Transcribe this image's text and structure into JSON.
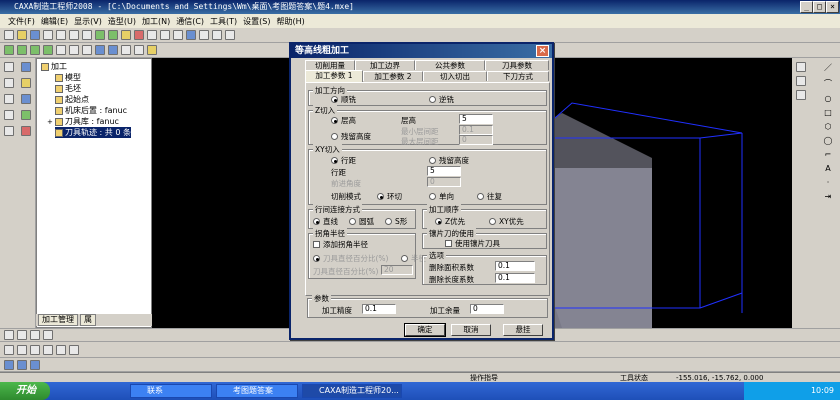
{
  "app": {
    "title": "CAXA制造工程师2008 - [C:\\Documents and Settings\\Wm\\桌面\\考图题答案\\题4.mxe]"
  },
  "menu": [
    "文件(F)",
    "编辑(E)",
    "显示(V)",
    "造型(U)",
    "加工(N)",
    "通信(C)",
    "工具(T)",
    "设置(S)",
    "帮助(H)"
  ],
  "tree": {
    "root": "加工",
    "items": [
      "模型",
      "毛坯",
      "起始点",
      "机床后置 : fanuc",
      "刀具库 : fanuc",
      "刀具轨迹 : 共 0 条"
    ]
  },
  "panel_tabs": [
    "加工管理",
    "属"
  ],
  "dialog": {
    "title": "等高线粗加工",
    "tabs_row1": [
      "切削用量",
      "加工边界",
      "公共参数",
      "刀具参数"
    ],
    "tabs_row2": [
      "加工参数 1",
      "加工参数 2",
      "切入切出",
      "下刀方式"
    ],
    "machining_direction": {
      "label": "加工方向",
      "options": [
        "顺铣",
        "逆铣"
      ],
      "selected": "顺铣"
    },
    "z_cut": {
      "label": "Z切入",
      "opt_layer_height": "层高",
      "opt_residual_height": "残留高度",
      "layer_height_label": "层高",
      "layer_height_value": "5",
      "min_layer_label": "最小层间距",
      "min_layer_value": "0.1",
      "max_layer_label": "最大层间距",
      "max_layer_value": "0"
    },
    "xy_cut": {
      "label": "XY切入",
      "opt_row_spacing": "行距",
      "opt_residual_height": "残留高度",
      "row_spacing_label": "行距",
      "row_spacing_value": "5",
      "angle_label": "前进角度",
      "angle_value": "0",
      "cut_mode_label": "切削模式",
      "cut_modes": [
        "环切",
        "单向",
        "往复"
      ],
      "cut_mode_selected": "环切"
    },
    "row_connect": {
      "label": "行间连接方式",
      "options": [
        "直线",
        "圆弧",
        "S形"
      ],
      "selected": "直线"
    },
    "corner": {
      "label": "拐角半径",
      "add_radius_label": "添加拐角半径",
      "pct_label": "刀具直径百分比(%)",
      "radius_label": "半径",
      "pct_input_label": "刀具直径百分比(%)",
      "pct_input_value": "20"
    },
    "order": {
      "label": "加工顺序",
      "options": [
        "Z优先",
        "XY优先"
      ],
      "selected": "Z优先"
    },
    "insert_tool": {
      "label": "镶片刀的使用",
      "check_label": "使用镶片刀具"
    },
    "options": {
      "label": "选项",
      "min_area_label": "删除面积系数",
      "min_area_value": "0.1",
      "min_length_label": "删除长度系数",
      "min_length_value": "0.1"
    },
    "params": {
      "label": "参数",
      "precision_label": "加工精度",
      "precision_value": "0.1",
      "allowance_label": "加工余量",
      "allowance_value": "0"
    },
    "buttons": {
      "ok": "确定",
      "cancel": "取消",
      "suspend": "悬挂"
    }
  },
  "status": {
    "prompt": "操作指导",
    "tool_state": "工具状态",
    "coords": "-155.016, -15.762, 0.000"
  },
  "taskbar": {
    "start": "开始",
    "tasks": [
      "联系",
      "考图题答案",
      "CAXA制造工程师20..."
    ],
    "time": "10:09"
  }
}
